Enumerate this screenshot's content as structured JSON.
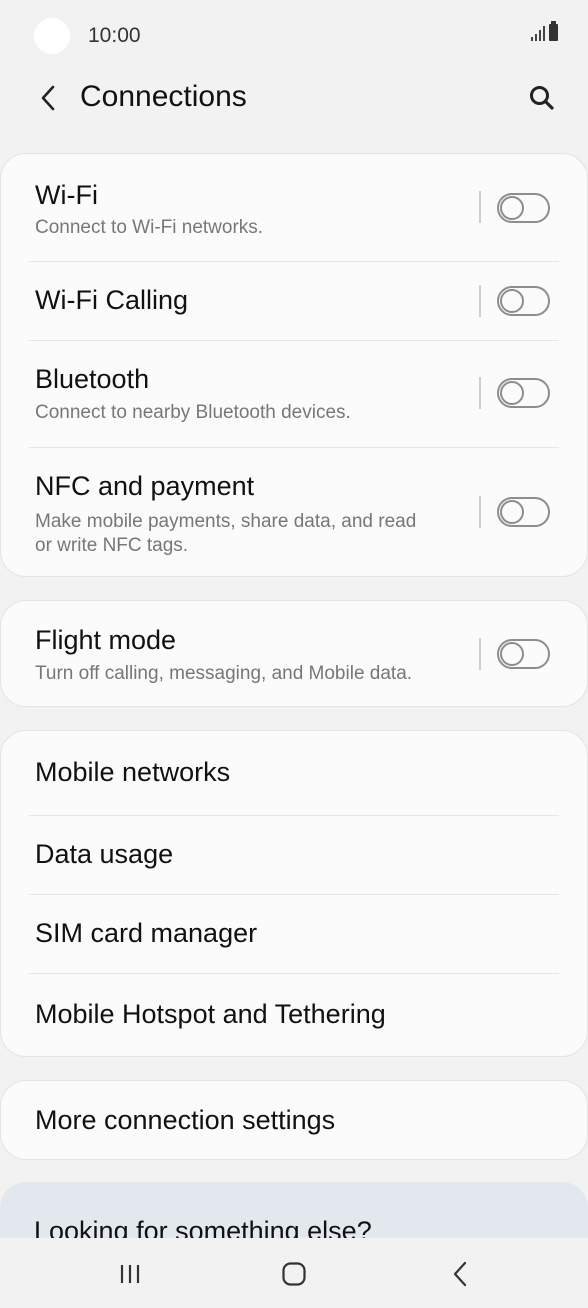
{
  "status_bar": {
    "time": "10:00",
    "icons": [
      "signal-icon",
      "battery-icon"
    ]
  },
  "app_bar": {
    "title": "Connections",
    "back_icon": "back-chevron-icon",
    "search_icon": "search-icon"
  },
  "groups": [
    {
      "items": [
        {
          "title": "Wi-Fi",
          "subtitle": "Connect to Wi-Fi networks.",
          "toggle": false
        },
        {
          "title": "Wi-Fi Calling",
          "toggle": false
        },
        {
          "title": "Bluetooth",
          "subtitle": "Connect to nearby Bluetooth devices.",
          "toggle": false
        },
        {
          "title": "NFC and payment",
          "subtitle_lines": [
            "Make mobile payments, share data, and read",
            "or write NFC tags."
          ],
          "toggle": false
        }
      ]
    },
    {
      "items": [
        {
          "title": "Flight mode",
          "subtitle": "Turn off calling, messaging, and Mobile data.",
          "toggle": false
        }
      ]
    },
    {
      "items": [
        {
          "title": "Mobile networks"
        },
        {
          "title": "Data usage"
        },
        {
          "title": "SIM card manager"
        },
        {
          "title": "Mobile Hotspot and Tethering"
        }
      ]
    },
    {
      "items": [
        {
          "title": "More connection settings"
        }
      ]
    }
  ],
  "suggestion": {
    "title": "Looking for something else?"
  },
  "nav_bar": {
    "icons": [
      "recent-apps-icon",
      "home-icon",
      "back-icon"
    ]
  },
  "colors": {
    "background": "#f2f2f2",
    "card": "#fbfbfb",
    "suggestion_card": "#e3e8ef",
    "toggle_off": "#8d8d8d"
  }
}
